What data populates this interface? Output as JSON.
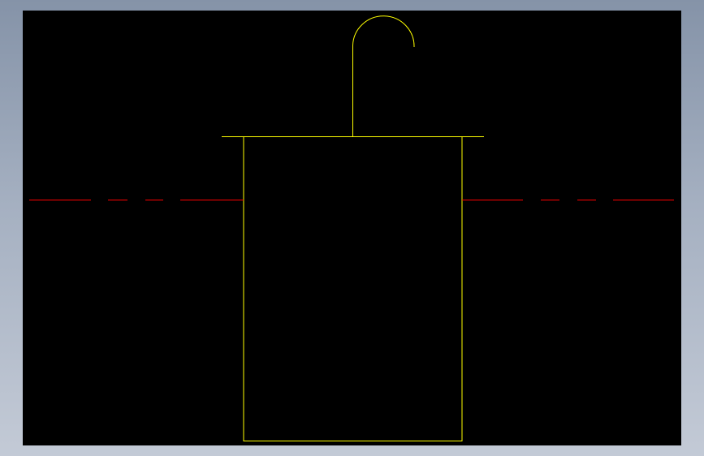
{
  "viewport": {
    "background": "#000000"
  },
  "colors": {
    "frame": "#8593a8",
    "geometry": "#ffff00",
    "centerline": "#ff0000"
  },
  "drawing": {
    "entities": [
      "top-flange-line",
      "body-rectangle",
      "hook-stem-line",
      "hook-arc",
      "centerline-left",
      "centerline-right"
    ]
  }
}
